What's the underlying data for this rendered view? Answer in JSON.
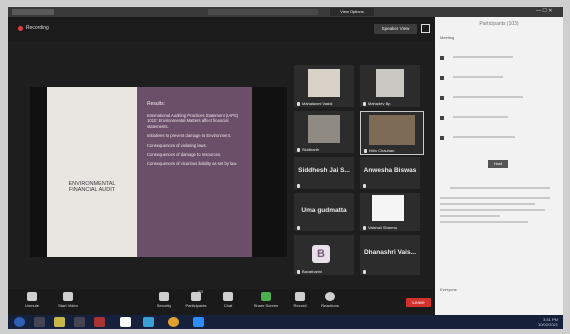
{
  "titlebar": {
    "view_options": "View Options",
    "window_controls": "— ☐ ✕"
  },
  "topbar": {
    "recording": "Recording",
    "speaker_view": "Speaker View"
  },
  "slide": {
    "left_title": "ENVIRONMENTAL FINANCIAL AUDIT",
    "results_title": "Results:",
    "bullets": [
      "International Auditing Practices Statement (IAPS) 1010: Environmental Matters affect financial statements.",
      "Initiatives to prevent damage to Environment.",
      "Consequences of violating laws.",
      "Consequences of damage to resources.",
      "Consequences of vicarious liability as set by law."
    ]
  },
  "participants": {
    "tile1": "Mahalaxmi Vaddi",
    "tile2": "Mahadev Bp",
    "tile3": "Siddharth",
    "tile4": "Nitin Chauhan",
    "tile5": "Siddhesh Jai S...",
    "tile6": "Anwesha Biswas",
    "tile7": "Uma gudmatta",
    "tile8": "Vaishali Sharma",
    "tile9": "Bavatharini",
    "tile10": "Dhanashri Vais...",
    "b_avatar": "B"
  },
  "controls": {
    "unmute": "Unmute",
    "start_video": "Start Video",
    "security": "Security",
    "participants": "Participants",
    "participants_count": "103",
    "chat": "Chat",
    "share": "Share Screen",
    "record": "Record",
    "reactions": "Reactions",
    "leave": "Leave"
  },
  "panel": {
    "title": "Participants (103)",
    "subtitle": "Meeting",
    "host_label": "Host",
    "footer": "Everyone"
  },
  "taskbar": {
    "time": "3:31 PM",
    "date": "10/02/2021"
  }
}
